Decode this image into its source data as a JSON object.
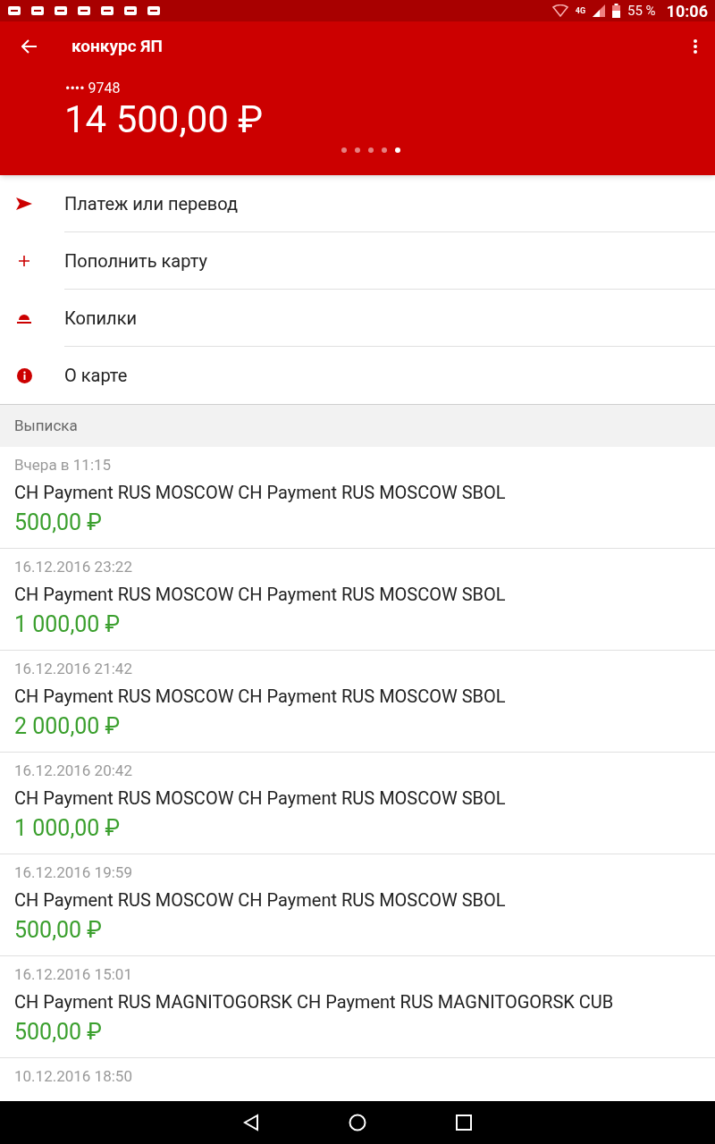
{
  "status_bar": {
    "network": "4G",
    "battery": "55 %",
    "time": "10:06"
  },
  "header": {
    "title": "конкурс ЯП",
    "card_number": "•••• 9748",
    "balance": "14 500,00 ₽",
    "pages": [
      {
        "selected": false
      },
      {
        "selected": false
      },
      {
        "selected": false
      },
      {
        "selected": false
      },
      {
        "selected": true
      }
    ]
  },
  "menu": [
    {
      "kind": "send",
      "label": "Платеж или перевод"
    },
    {
      "kind": "add",
      "label": "Пополнить карту"
    },
    {
      "kind": "savings",
      "label": "Копилки"
    },
    {
      "kind": "info",
      "label": "О карте"
    }
  ],
  "statement": {
    "title": "Выписка",
    "transactions": [
      {
        "date": "Вчера в 11:15",
        "description": "CH Payment RUS MOSCOW CH Payment RUS MOSCOW SBOL",
        "amount": "500,00 ₽"
      },
      {
        "date": "16.12.2016 23:22",
        "description": "CH Payment RUS MOSCOW CH Payment RUS MOSCOW SBOL",
        "amount": "1 000,00 ₽"
      },
      {
        "date": "16.12.2016 21:42",
        "description": "CH Payment RUS MOSCOW CH Payment RUS MOSCOW SBOL",
        "amount": "2 000,00 ₽"
      },
      {
        "date": "16.12.2016 20:42",
        "description": "CH Payment RUS MOSCOW CH Payment RUS MOSCOW SBOL",
        "amount": "1 000,00 ₽"
      },
      {
        "date": "16.12.2016 19:59",
        "description": "CH Payment RUS MOSCOW CH Payment RUS MOSCOW SBOL",
        "amount": "500,00 ₽"
      },
      {
        "date": "16.12.2016 15:01",
        "description": "CH Payment RUS MAGNITOGORSK CH Payment RUS MAGNITOGORSK CUB",
        "amount": "500,00 ₽"
      },
      {
        "date": "10.12.2016 18:50"
      }
    ]
  }
}
